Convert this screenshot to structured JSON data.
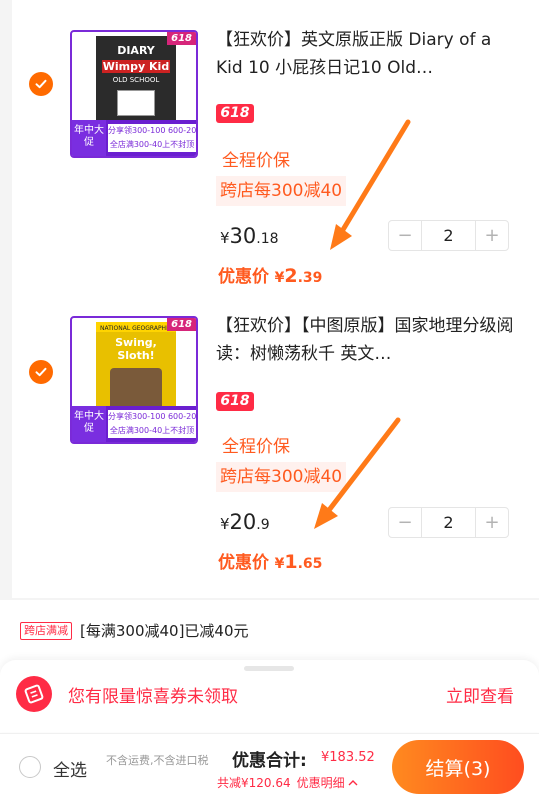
{
  "items": [
    {
      "title": "【狂欢价】英文原版正版 Diary of a Kid 10 小屁孩日记10 Old…",
      "badge": "618",
      "promo1": "全程价保",
      "promo2": "跨店每300减40",
      "price": {
        "currency": "¥",
        "integer": "30",
        "decimal": ".18"
      },
      "quantity": "2",
      "deal": {
        "label": "优惠价",
        "currency": "¥",
        "integer": "2",
        "decimal": ".39"
      },
      "thumb": {
        "tag": "618",
        "band_left": "年中大促",
        "band_right_1": "分享领300-100 600-200大额券",
        "band_right_2": "全店满300-40上不封顶",
        "cover_1": "DIARY",
        "cover_2": "Wimpy Kid",
        "cover_3": "OLD SCHOOL"
      }
    },
    {
      "title": "【狂欢价】【中图原版】国家地理分级阅读：树懒荡秋千 英文…",
      "badge": "618",
      "promo1": "全程价保",
      "promo2": "跨店每300减40",
      "price": {
        "currency": "¥",
        "integer": "20",
        "decimal": ".9"
      },
      "quantity": "2",
      "deal": {
        "label": "优惠价",
        "currency": "¥",
        "integer": "1",
        "decimal": ".65"
      },
      "thumb": {
        "tag": "618",
        "band_left": "年中大促",
        "band_right_1": "分享领300-100 600-200大额券",
        "band_right_2": "全店满300-40上不封顶",
        "cover_1": "NATIONAL GEOGRAPHIC",
        "cover_2": "Swing, Sloth!",
        "cover_3": ""
      }
    }
  ],
  "summary": {
    "tag": "跨店满减",
    "text": "[每满300减40]已减40元"
  },
  "coupon": {
    "text": "您有限量惊喜券未领取",
    "link": "立即查看"
  },
  "bottom": {
    "select_all": "全选",
    "ship_note": "不含运费,不含进口税",
    "total_label": "优惠合计:",
    "total_value": "¥183.52",
    "saved": "共减¥120.64",
    "detail": "优惠明细",
    "detail_icon": "chevron-up-icon",
    "checkout": "结算(3)"
  },
  "colors": {
    "accent": "#ff5a1f",
    "red": "#ff2b45",
    "check": "#ff6a00",
    "book_border": "#7a2ad8"
  }
}
